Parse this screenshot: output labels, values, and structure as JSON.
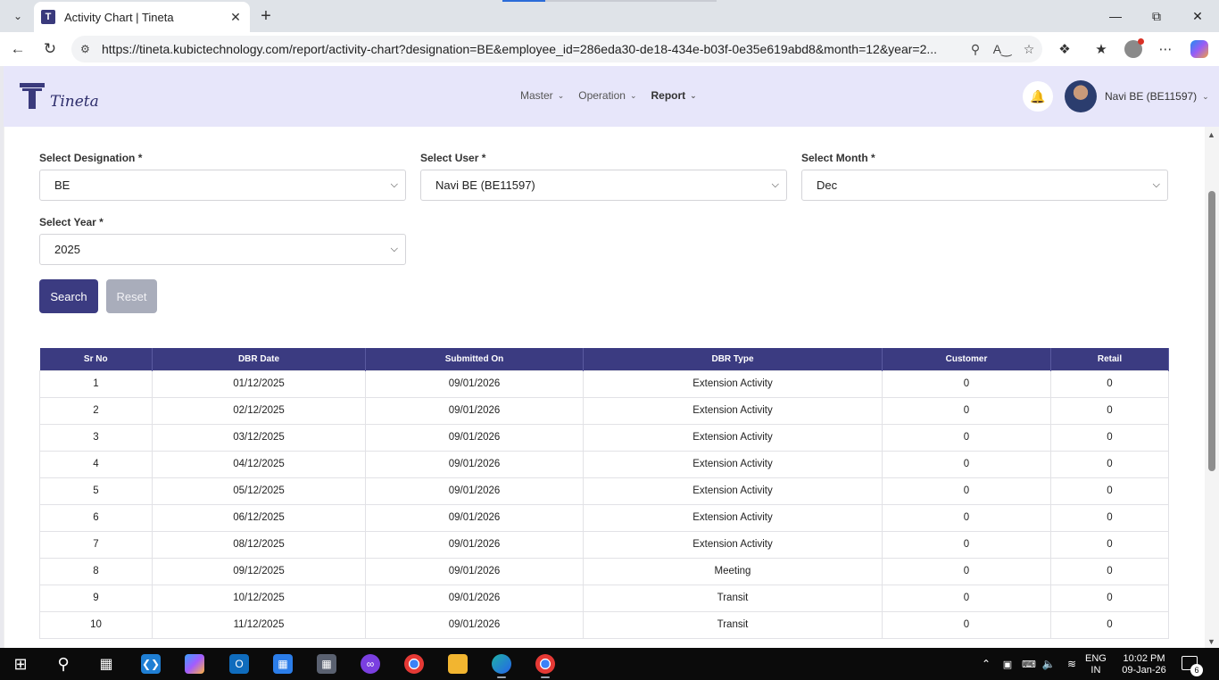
{
  "browser": {
    "tab_title": "Activity Chart | Tineta",
    "tab_favicon": "T",
    "url": "https://tineta.kubictechnology.com/report/activity-chart?designation=BE&employee_id=286eda30-de18-434e-b03f-0e35e619abd8&month=12&year=2..."
  },
  "app": {
    "logo_text": "Tineta",
    "nav": [
      {
        "label": "Master"
      },
      {
        "label": "Operation"
      },
      {
        "label": "Report"
      }
    ],
    "user_name": "Navi BE (BE11597)"
  },
  "filters": {
    "designation": {
      "label": "Select Designation *",
      "value": "BE"
    },
    "user": {
      "label": "Select User *",
      "value": "Navi BE (BE11597)"
    },
    "month": {
      "label": "Select Month *",
      "value": "Dec"
    },
    "year": {
      "label": "Select Year *",
      "value": "2025"
    }
  },
  "buttons": {
    "search": "Search",
    "reset": "Reset"
  },
  "table": {
    "columns": [
      "Sr No",
      "DBR Date",
      "Submitted On",
      "DBR Type",
      "Customer",
      "Retail"
    ],
    "rows": [
      [
        "1",
        "01/12/2025",
        "09/01/2026",
        "Extension Activity",
        "0",
        "0"
      ],
      [
        "2",
        "02/12/2025",
        "09/01/2026",
        "Extension Activity",
        "0",
        "0"
      ],
      [
        "3",
        "03/12/2025",
        "09/01/2026",
        "Extension Activity",
        "0",
        "0"
      ],
      [
        "4",
        "04/12/2025",
        "09/01/2026",
        "Extension Activity",
        "0",
        "0"
      ],
      [
        "5",
        "05/12/2025",
        "09/01/2026",
        "Extension Activity",
        "0",
        "0"
      ],
      [
        "6",
        "06/12/2025",
        "09/01/2026",
        "Extension Activity",
        "0",
        "0"
      ],
      [
        "7",
        "08/12/2025",
        "09/01/2026",
        "Extension Activity",
        "0",
        "0"
      ],
      [
        "8",
        "09/12/2025",
        "09/01/2026",
        "Meeting",
        "0",
        "0"
      ],
      [
        "9",
        "10/12/2025",
        "09/01/2026",
        "Transit",
        "0",
        "0"
      ],
      [
        "10",
        "11/12/2025",
        "09/01/2026",
        "Transit",
        "0",
        "0"
      ]
    ]
  },
  "taskbar": {
    "lang_top": "ENG",
    "lang_bottom": "IN",
    "time": "10:02 PM",
    "date": "09-Jan-26",
    "notification_count": "6"
  },
  "colors": {
    "primary": "#3b3b81",
    "header_bg": "#e7e6fa",
    "reset_bg": "#a9adbb"
  }
}
